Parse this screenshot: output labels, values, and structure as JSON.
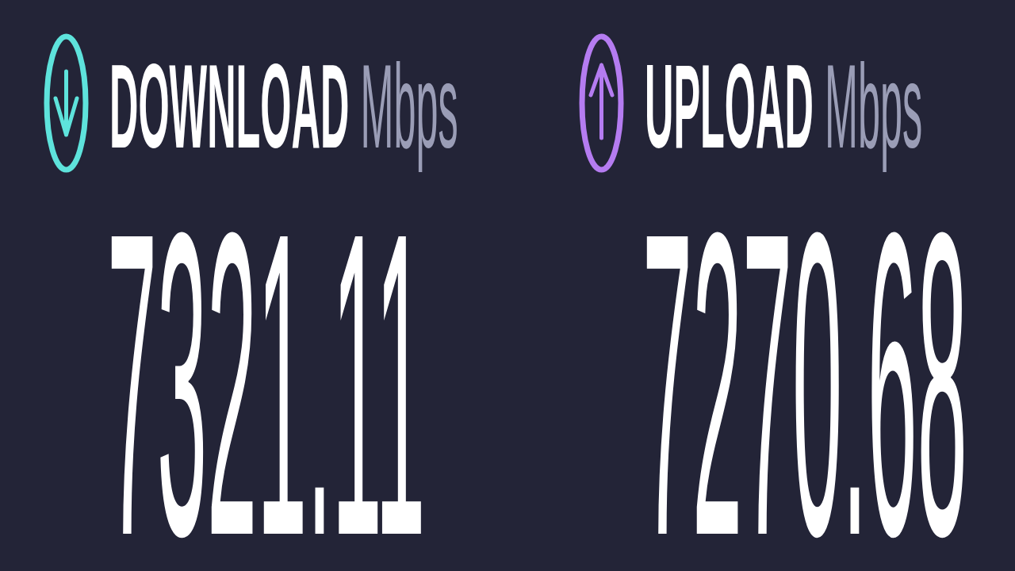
{
  "results": [
    {
      "kind": "download",
      "color": "#5ee3dc",
      "label": "DOWNLOAD",
      "unit": "Mbps",
      "value": "7321.11"
    },
    {
      "kind": "upload",
      "color": "#b57cf1",
      "label": "UPLOAD",
      "unit": "Mbps",
      "value": "7270.68"
    }
  ]
}
